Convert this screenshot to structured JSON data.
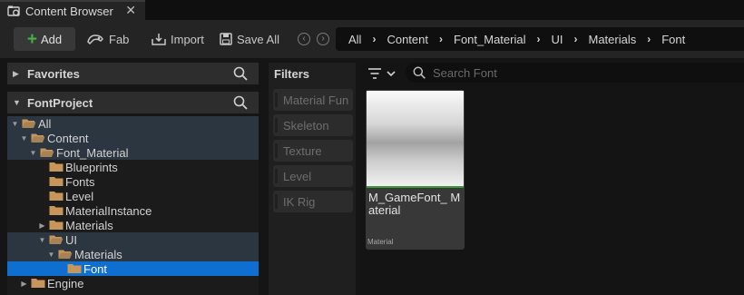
{
  "window": {
    "tab_title": "Content Browser",
    "close_glyph": "✕"
  },
  "toolbar": {
    "add_label": "Add",
    "fab_label": "Fab",
    "import_label": "Import",
    "save_all_label": "Save All"
  },
  "breadcrumb": [
    "All",
    "Content",
    "Font_Material",
    "UI",
    "Materials",
    "Font"
  ],
  "panels": {
    "favorites_title": "Favorites",
    "project_title": "FontProject"
  },
  "tree": [
    {
      "label": "All",
      "indent": 0,
      "twisty": "open",
      "folder": "open",
      "state": "hl"
    },
    {
      "label": "Content",
      "indent": 1,
      "twisty": "open",
      "folder": "open",
      "state": "hl"
    },
    {
      "label": "Font_Material",
      "indent": 2,
      "twisty": "open",
      "folder": "open",
      "state": "hl"
    },
    {
      "label": "Blueprints",
      "indent": 3,
      "twisty": "none",
      "folder": "closed",
      "state": ""
    },
    {
      "label": "Fonts",
      "indent": 3,
      "twisty": "none",
      "folder": "closed",
      "state": ""
    },
    {
      "label": "Level",
      "indent": 3,
      "twisty": "none",
      "folder": "closed",
      "state": ""
    },
    {
      "label": "MaterialInstance",
      "indent": 3,
      "twisty": "none",
      "folder": "closed",
      "state": ""
    },
    {
      "label": "Materials",
      "indent": 3,
      "twisty": "closed",
      "folder": "closed",
      "state": ""
    },
    {
      "label": "UI",
      "indent": 3,
      "twisty": "open",
      "folder": "open",
      "state": "hl"
    },
    {
      "label": "Materials",
      "indent": 4,
      "twisty": "open",
      "folder": "open",
      "state": "hl"
    },
    {
      "label": "Font",
      "indent": 5,
      "twisty": "none",
      "folder": "closed",
      "state": "sel"
    },
    {
      "label": "Engine",
      "indent": 1,
      "twisty": "closed",
      "folder": "closed",
      "state": ""
    }
  ],
  "filters": {
    "title": "Filters",
    "items": [
      "Material Fun",
      "Skeleton",
      "Texture",
      "Level",
      "IK Rig"
    ]
  },
  "search": {
    "placeholder": "Search Font"
  },
  "asset": {
    "name": "M_GameFont_ Material",
    "type": "Material"
  },
  "colors": {
    "folder": "#c7965a",
    "selection": "#0f6fd1",
    "add_plus": "#44b347",
    "thumb_underline": "#3a9a3a"
  }
}
